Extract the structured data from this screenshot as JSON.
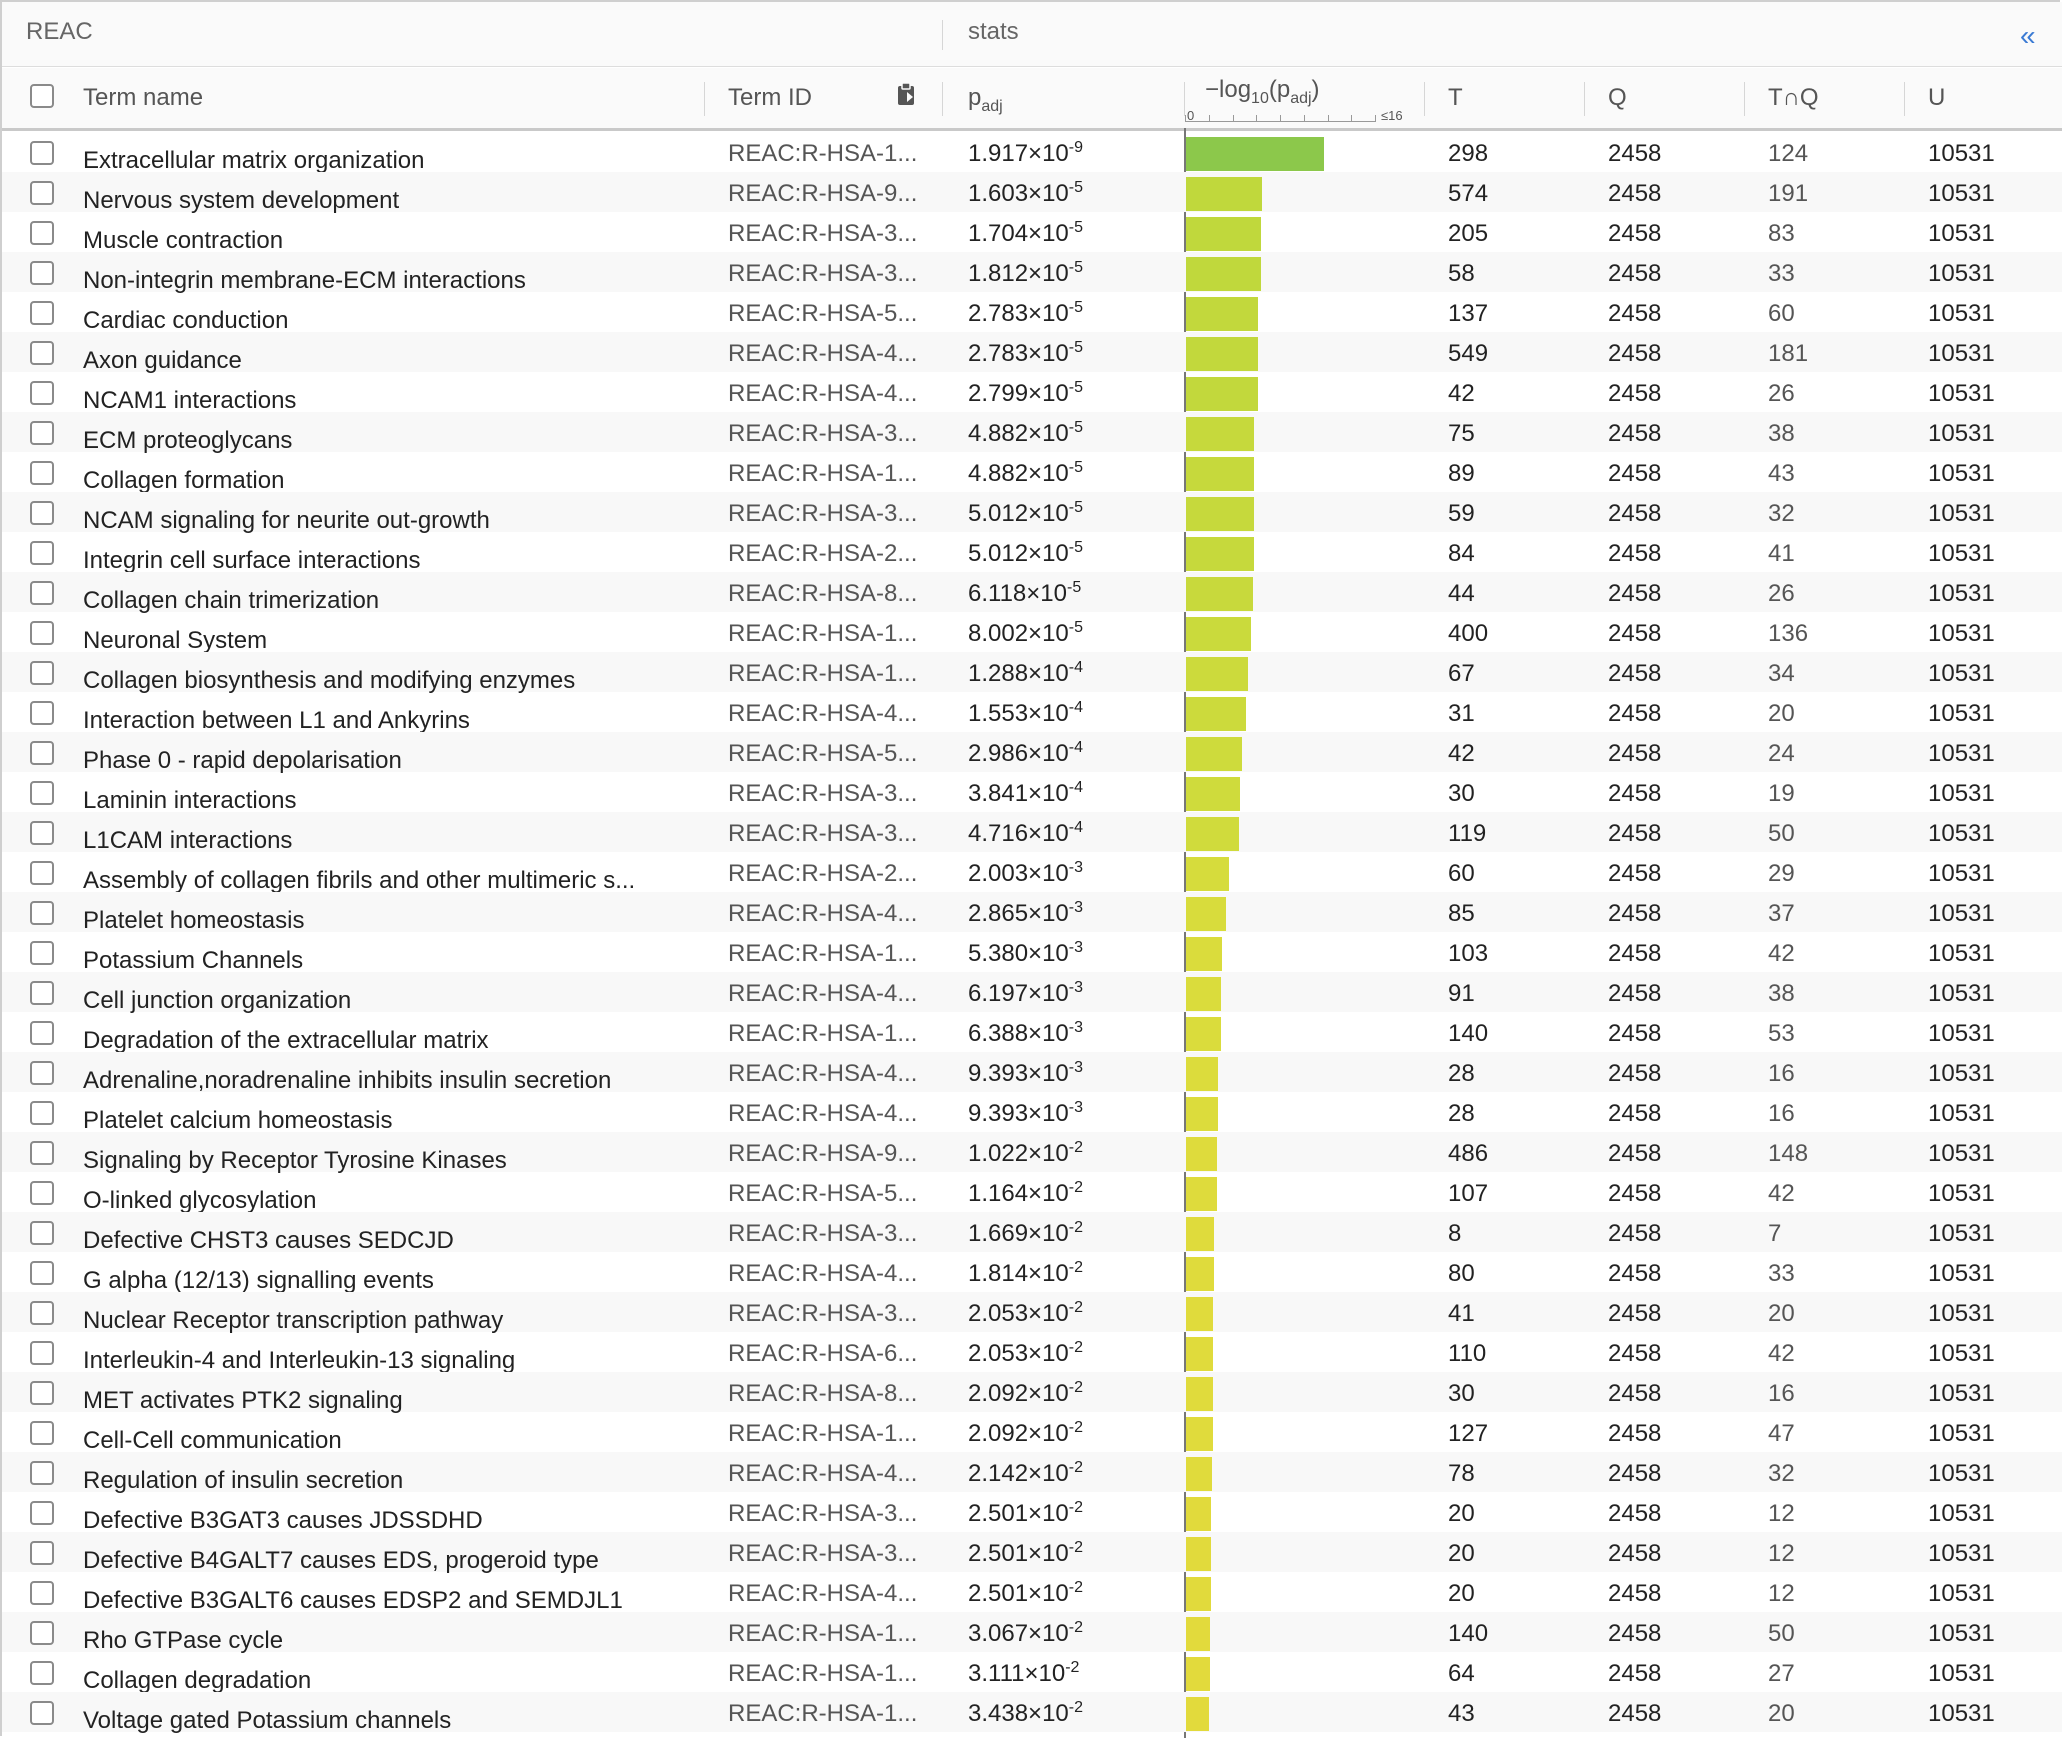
{
  "section": {
    "source": "REAC",
    "stats": "stats",
    "collapse_icon": "«"
  },
  "headers": {
    "term_name": "Term name",
    "term_id": "Term ID",
    "p_adj_main": "p",
    "p_adj_sub": "adj",
    "neglog_prefix": "−log",
    "neglog_sub": "10",
    "neglog_mid": "(p",
    "neglog_sub2": "adj",
    "neglog_end": ")",
    "axis_min": "0",
    "axis_max": "≤16",
    "t": "T",
    "q": "Q",
    "tq": "T∩Q",
    "u": "U"
  },
  "bar_scale_max": 16,
  "rows": [
    {
      "name": "Extracellular matrix organization",
      "id": "REAC:R-HSA-1...",
      "p_mant": "1.917",
      "p_exp": "-9",
      "neglog": 8.717,
      "t": "298",
      "q": "2458",
      "tq": "124",
      "u": "10531",
      "color": "#8cc84b"
    },
    {
      "name": "Nervous system development",
      "id": "REAC:R-HSA-9...",
      "p_mant": "1.603",
      "p_exp": "-5",
      "neglog": 4.795,
      "t": "574",
      "q": "2458",
      "tq": "191",
      "u": "10531",
      "color": "#c0d83c"
    },
    {
      "name": "Muscle contraction",
      "id": "REAC:R-HSA-3...",
      "p_mant": "1.704",
      "p_exp": "-5",
      "neglog": 4.769,
      "t": "205",
      "q": "2458",
      "tq": "83",
      "u": "10531",
      "color": "#c0d83c"
    },
    {
      "name": "Non-integrin membrane-ECM interactions",
      "id": "REAC:R-HSA-3...",
      "p_mant": "1.812",
      "p_exp": "-5",
      "neglog": 4.742,
      "t": "58",
      "q": "2458",
      "tq": "33",
      "u": "10531",
      "color": "#c0d83c"
    },
    {
      "name": "Cardiac conduction",
      "id": "REAC:R-HSA-5...",
      "p_mant": "2.783",
      "p_exp": "-5",
      "neglog": 4.555,
      "t": "137",
      "q": "2458",
      "tq": "60",
      "u": "10531",
      "color": "#c2d83c"
    },
    {
      "name": "Axon guidance",
      "id": "REAC:R-HSA-4...",
      "p_mant": "2.783",
      "p_exp": "-5",
      "neglog": 4.555,
      "t": "549",
      "q": "2458",
      "tq": "181",
      "u": "10531",
      "color": "#c2d83c"
    },
    {
      "name": "NCAM1 interactions",
      "id": "REAC:R-HSA-4...",
      "p_mant": "2.799",
      "p_exp": "-5",
      "neglog": 4.553,
      "t": "42",
      "q": "2458",
      "tq": "26",
      "u": "10531",
      "color": "#c2d83c"
    },
    {
      "name": "ECM proteoglycans",
      "id": "REAC:R-HSA-3...",
      "p_mant": "4.882",
      "p_exp": "-5",
      "neglog": 4.311,
      "t": "75",
      "q": "2458",
      "tq": "38",
      "u": "10531",
      "color": "#c6d93c"
    },
    {
      "name": "Collagen formation",
      "id": "REAC:R-HSA-1...",
      "p_mant": "4.882",
      "p_exp": "-5",
      "neglog": 4.311,
      "t": "89",
      "q": "2458",
      "tq": "43",
      "u": "10531",
      "color": "#c6d93c"
    },
    {
      "name": "NCAM signaling for neurite out-growth",
      "id": "REAC:R-HSA-3...",
      "p_mant": "5.012",
      "p_exp": "-5",
      "neglog": 4.3,
      "t": "59",
      "q": "2458",
      "tq": "32",
      "u": "10531",
      "color": "#c6d93c"
    },
    {
      "name": "Integrin cell surface interactions",
      "id": "REAC:R-HSA-2...",
      "p_mant": "5.012",
      "p_exp": "-5",
      "neglog": 4.3,
      "t": "84",
      "q": "2458",
      "tq": "41",
      "u": "10531",
      "color": "#c6d93c"
    },
    {
      "name": "Collagen chain trimerization",
      "id": "REAC:R-HSA-8...",
      "p_mant": "6.118",
      "p_exp": "-5",
      "neglog": 4.213,
      "t": "44",
      "q": "2458",
      "tq": "26",
      "u": "10531",
      "color": "#c8d93c"
    },
    {
      "name": "Neuronal System",
      "id": "REAC:R-HSA-1...",
      "p_mant": "8.002",
      "p_exp": "-5",
      "neglog": 4.097,
      "t": "400",
      "q": "2458",
      "tq": "136",
      "u": "10531",
      "color": "#cada3c"
    },
    {
      "name": "Collagen biosynthesis and modifying enzymes",
      "id": "REAC:R-HSA-1...",
      "p_mant": "1.288",
      "p_exp": "-4",
      "neglog": 3.89,
      "t": "67",
      "q": "2458",
      "tq": "34",
      "u": "10531",
      "color": "#ccda3c"
    },
    {
      "name": "Interaction between L1 and Ankyrins",
      "id": "REAC:R-HSA-4...",
      "p_mant": "1.553",
      "p_exp": "-4",
      "neglog": 3.809,
      "t": "31",
      "q": "2458",
      "tq": "20",
      "u": "10531",
      "color": "#ccda3c"
    },
    {
      "name": "Phase 0 - rapid depolarisation",
      "id": "REAC:R-HSA-5...",
      "p_mant": "2.986",
      "p_exp": "-4",
      "neglog": 3.525,
      "t": "42",
      "q": "2458",
      "tq": "24",
      "u": "10531",
      "color": "#cedb3c"
    },
    {
      "name": "Laminin interactions",
      "id": "REAC:R-HSA-3...",
      "p_mant": "3.841",
      "p_exp": "-4",
      "neglog": 3.416,
      "t": "30",
      "q": "2458",
      "tq": "19",
      "u": "10531",
      "color": "#cfdb3c"
    },
    {
      "name": "L1CAM interactions",
      "id": "REAC:R-HSA-3...",
      "p_mant": "4.716",
      "p_exp": "-4",
      "neglog": 3.326,
      "t": "119",
      "q": "2458",
      "tq": "50",
      "u": "10531",
      "color": "#d0db3c"
    },
    {
      "name": "Assembly of collagen fibrils and other multimeric s...",
      "id": "REAC:R-HSA-2...",
      "p_mant": "2.003",
      "p_exp": "-3",
      "neglog": 2.698,
      "t": "60",
      "q": "2458",
      "tq": "29",
      "u": "10531",
      "color": "#d6dc3c"
    },
    {
      "name": "Platelet homeostasis",
      "id": "REAC:R-HSA-4...",
      "p_mant": "2.865",
      "p_exp": "-3",
      "neglog": 2.543,
      "t": "85",
      "q": "2458",
      "tq": "37",
      "u": "10531",
      "color": "#d8dc3c"
    },
    {
      "name": "Potassium Channels",
      "id": "REAC:R-HSA-1...",
      "p_mant": "5.380",
      "p_exp": "-3",
      "neglog": 2.269,
      "t": "103",
      "q": "2458",
      "tq": "42",
      "u": "10531",
      "color": "#dadc3c"
    },
    {
      "name": "Cell junction organization",
      "id": "REAC:R-HSA-4...",
      "p_mant": "6.197",
      "p_exp": "-3",
      "neglog": 2.208,
      "t": "91",
      "q": "2458",
      "tq": "38",
      "u": "10531",
      "color": "#dadc3c"
    },
    {
      "name": "Degradation of the extracellular matrix",
      "id": "REAC:R-HSA-1...",
      "p_mant": "6.388",
      "p_exp": "-3",
      "neglog": 2.195,
      "t": "140",
      "q": "2458",
      "tq": "53",
      "u": "10531",
      "color": "#dadc3c"
    },
    {
      "name": "Adrenaline,noradrenaline inhibits insulin secretion",
      "id": "REAC:R-HSA-4...",
      "p_mant": "9.393",
      "p_exp": "-3",
      "neglog": 2.027,
      "t": "28",
      "q": "2458",
      "tq": "16",
      "u": "10531",
      "color": "#dcdc3c"
    },
    {
      "name": "Platelet calcium homeostasis",
      "id": "REAC:R-HSA-4...",
      "p_mant": "9.393",
      "p_exp": "-3",
      "neglog": 2.027,
      "t": "28",
      "q": "2458",
      "tq": "16",
      "u": "10531",
      "color": "#dcdc3c"
    },
    {
      "name": "Signaling by Receptor Tyrosine Kinases",
      "id": "REAC:R-HSA-9...",
      "p_mant": "1.022",
      "p_exp": "-2",
      "neglog": 1.991,
      "t": "486",
      "q": "2458",
      "tq": "148",
      "u": "10531",
      "color": "#dedb3c"
    },
    {
      "name": "O-linked glycosylation",
      "id": "REAC:R-HSA-5...",
      "p_mant": "1.164",
      "p_exp": "-2",
      "neglog": 1.934,
      "t": "107",
      "q": "2458",
      "tq": "42",
      "u": "10531",
      "color": "#dedb3c"
    },
    {
      "name": "Defective CHST3 causes SEDCJD",
      "id": "REAC:R-HSA-3...",
      "p_mant": "1.669",
      "p_exp": "-2",
      "neglog": 1.778,
      "t": "8",
      "q": "2458",
      "tq": "7",
      "u": "10531",
      "color": "#dfdb3c"
    },
    {
      "name": "G alpha (12/13) signalling events",
      "id": "REAC:R-HSA-4...",
      "p_mant": "1.814",
      "p_exp": "-2",
      "neglog": 1.741,
      "t": "80",
      "q": "2458",
      "tq": "33",
      "u": "10531",
      "color": "#dfdb3c"
    },
    {
      "name": "Nuclear Receptor transcription pathway",
      "id": "REAC:R-HSA-3...",
      "p_mant": "2.053",
      "p_exp": "-2",
      "neglog": 1.688,
      "t": "41",
      "q": "2458",
      "tq": "20",
      "u": "10531",
      "color": "#e0db3c"
    },
    {
      "name": "Interleukin-4 and Interleukin-13 signaling",
      "id": "REAC:R-HSA-6...",
      "p_mant": "2.053",
      "p_exp": "-2",
      "neglog": 1.688,
      "t": "110",
      "q": "2458",
      "tq": "42",
      "u": "10531",
      "color": "#e0db3c"
    },
    {
      "name": "MET activates PTK2 signaling",
      "id": "REAC:R-HSA-8...",
      "p_mant": "2.092",
      "p_exp": "-2",
      "neglog": 1.679,
      "t": "30",
      "q": "2458",
      "tq": "16",
      "u": "10531",
      "color": "#e0db3c"
    },
    {
      "name": "Cell-Cell communication",
      "id": "REAC:R-HSA-1...",
      "p_mant": "2.092",
      "p_exp": "-2",
      "neglog": 1.679,
      "t": "127",
      "q": "2458",
      "tq": "47",
      "u": "10531",
      "color": "#e0db3c"
    },
    {
      "name": "Regulation of insulin secretion",
      "id": "REAC:R-HSA-4...",
      "p_mant": "2.142",
      "p_exp": "-2",
      "neglog": 1.669,
      "t": "78",
      "q": "2458",
      "tq": "32",
      "u": "10531",
      "color": "#e0db3c"
    },
    {
      "name": "Defective B3GAT3 causes JDSSDHD",
      "id": "REAC:R-HSA-3...",
      "p_mant": "2.501",
      "p_exp": "-2",
      "neglog": 1.602,
      "t": "20",
      "q": "2458",
      "tq": "12",
      "u": "10531",
      "color": "#e1da3c"
    },
    {
      "name": "Defective B4GALT7 causes EDS, progeroid type",
      "id": "REAC:R-HSA-3...",
      "p_mant": "2.501",
      "p_exp": "-2",
      "neglog": 1.602,
      "t": "20",
      "q": "2458",
      "tq": "12",
      "u": "10531",
      "color": "#e1da3c"
    },
    {
      "name": "Defective B3GALT6 causes EDSP2 and SEMDJL1",
      "id": "REAC:R-HSA-4...",
      "p_mant": "2.501",
      "p_exp": "-2",
      "neglog": 1.602,
      "t": "20",
      "q": "2458",
      "tq": "12",
      "u": "10531",
      "color": "#e1da3c"
    },
    {
      "name": "Rho GTPase cycle",
      "id": "REAC:R-HSA-1...",
      "p_mant": "3.067",
      "p_exp": "-2",
      "neglog": 1.513,
      "t": "140",
      "q": "2458",
      "tq": "50",
      "u": "10531",
      "color": "#e2da3c"
    },
    {
      "name": "Collagen degradation",
      "id": "REAC:R-HSA-1...",
      "p_mant": "3.111",
      "p_exp": "-2",
      "neglog": 1.507,
      "t": "64",
      "q": "2458",
      "tq": "27",
      "u": "10531",
      "color": "#e2da3c"
    },
    {
      "name": "Voltage gated Potassium channels",
      "id": "REAC:R-HSA-1...",
      "p_mant": "3.438",
      "p_exp": "-2",
      "neglog": 1.464,
      "t": "43",
      "q": "2458",
      "tq": "20",
      "u": "10531",
      "color": "#e2da3c"
    }
  ]
}
